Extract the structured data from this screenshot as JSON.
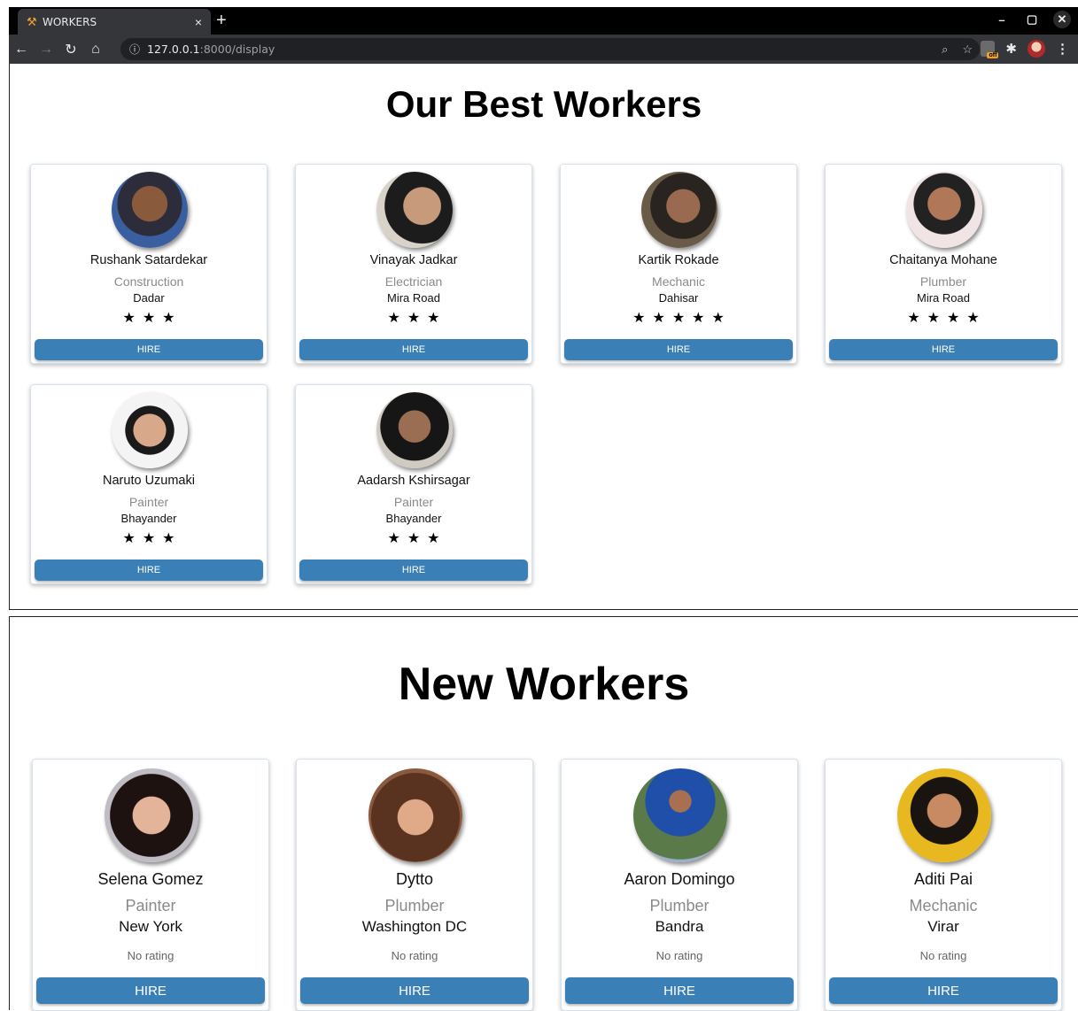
{
  "browser": {
    "tab_title": "WORKERS",
    "tab_close": "×",
    "new_tab": "+",
    "url_host": "127.0.0.1",
    "url_path": ":8000/display",
    "controls": {
      "minimize": "–",
      "restore": "▢",
      "close": "✕"
    },
    "extension_badge": "off"
  },
  "best_workers": {
    "title": "Our Best Workers",
    "workers": [
      {
        "name": "Rushank Satardekar",
        "role": "Construction",
        "location": "Dadar",
        "stars": 3,
        "button": "HIRE"
      },
      {
        "name": "Vinayak Jadkar",
        "role": "Electrician",
        "location": "Mira Road",
        "stars": 3,
        "button": "HIRE"
      },
      {
        "name": "Kartik Rokade",
        "role": "Mechanic",
        "location": "Dahisar",
        "stars": 5,
        "button": "HIRE"
      },
      {
        "name": "Chaitanya Mohane",
        "role": "Plumber",
        "location": "Mira Road",
        "stars": 4,
        "button": "HIRE"
      },
      {
        "name": "Naruto Uzumaki",
        "role": "Painter",
        "location": "Bhayander",
        "stars": 3,
        "button": "HIRE"
      },
      {
        "name": "Aadarsh Kshirsagar",
        "role": "Painter",
        "location": "Bhayander",
        "stars": 3,
        "button": "HIRE"
      }
    ]
  },
  "new_workers": {
    "title": "New Workers",
    "workers": [
      {
        "name": "Selena Gomez",
        "role": "Painter",
        "location": "New York",
        "rating": "No rating",
        "button": "HIRE"
      },
      {
        "name": "Dytto",
        "role": "Plumber",
        "location": "Washington DC",
        "rating": "No rating",
        "button": "HIRE"
      },
      {
        "name": "Aaron Domingo",
        "role": "Plumber",
        "location": "Bandra",
        "rating": "No rating",
        "button": "HIRE"
      },
      {
        "name": "Aditi Pai",
        "role": "Mechanic",
        "location": "Virar",
        "rating": "No rating",
        "button": "HIRE"
      }
    ]
  },
  "colors": {
    "hire_button": "#3a7fb5",
    "role_text": "#8a8a8a"
  }
}
